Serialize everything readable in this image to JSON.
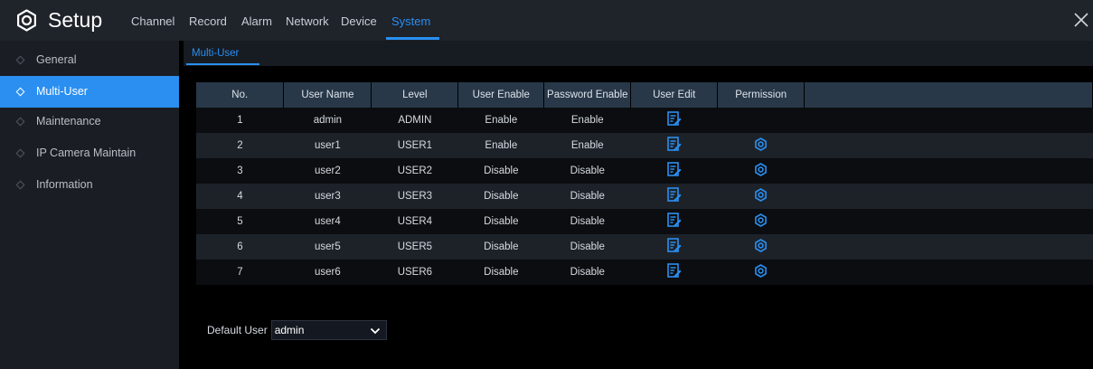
{
  "header": {
    "title": "Setup",
    "icon": "gear-icon",
    "close_icon": "close-icon",
    "accent": "#2a8ff0",
    "tabs": [
      {
        "label": "Channel",
        "active": false
      },
      {
        "label": "Record",
        "active": false
      },
      {
        "label": "Alarm",
        "active": false
      },
      {
        "label": "Network",
        "active": false
      },
      {
        "label": "Device",
        "active": false
      },
      {
        "label": "System",
        "active": true
      }
    ]
  },
  "sidebar": {
    "items": [
      {
        "label": "General",
        "active": false
      },
      {
        "label": "Multi-User",
        "active": true
      },
      {
        "label": "Maintenance",
        "active": false
      },
      {
        "label": "IP Camera Maintain",
        "active": false
      },
      {
        "label": "Information",
        "active": false
      }
    ]
  },
  "main": {
    "subtab": "Multi-User",
    "columns": [
      "No.",
      "User Name",
      "Level",
      "User Enable",
      "Password Enable",
      "User Edit",
      "Permission"
    ],
    "rows": [
      {
        "no": "1",
        "user": "admin",
        "level": "ADMIN",
        "enable": "Enable",
        "password": "Enable",
        "edit_icon": "edit-icon",
        "permission_icon": ""
      },
      {
        "no": "2",
        "user": "user1",
        "level": "USER1",
        "enable": "Enable",
        "password": "Enable",
        "edit_icon": "edit-icon",
        "permission_icon": "gear-icon"
      },
      {
        "no": "3",
        "user": "user2",
        "level": "USER2",
        "enable": "Disable",
        "password": "Disable",
        "edit_icon": "edit-icon",
        "permission_icon": "gear-icon"
      },
      {
        "no": "4",
        "user": "user3",
        "level": "USER3",
        "enable": "Disable",
        "password": "Disable",
        "edit_icon": "edit-icon",
        "permission_icon": "gear-icon"
      },
      {
        "no": "5",
        "user": "user4",
        "level": "USER4",
        "enable": "Disable",
        "password": "Disable",
        "edit_icon": "edit-icon",
        "permission_icon": "gear-icon"
      },
      {
        "no": "6",
        "user": "user5",
        "level": "USER5",
        "enable": "Disable",
        "password": "Disable",
        "edit_icon": "edit-icon",
        "permission_icon": "gear-icon"
      },
      {
        "no": "7",
        "user": "user6",
        "level": "USER6",
        "enable": "Disable",
        "password": "Disable",
        "edit_icon": "edit-icon",
        "permission_icon": "gear-icon"
      }
    ],
    "default_user": {
      "label": "Default User",
      "value": "admin"
    }
  }
}
